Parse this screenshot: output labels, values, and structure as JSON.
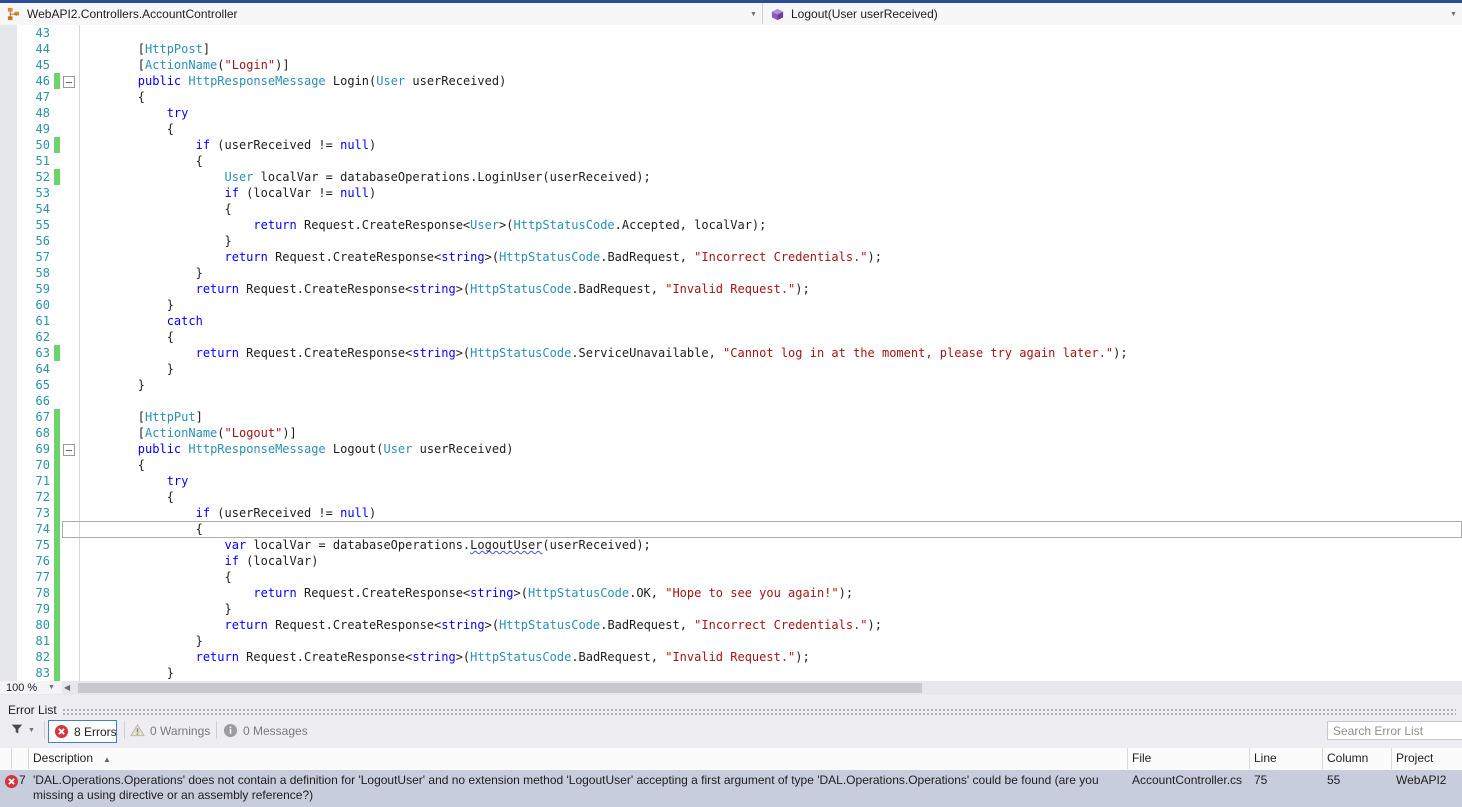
{
  "nav": {
    "type_combo": "WebAPI2.Controllers.AccountController",
    "member_combo": "Logout(User userReceived)"
  },
  "editor": {
    "zoom": "100 %",
    "lines": [
      {
        "n": 43,
        "seg": []
      },
      {
        "n": 44,
        "seg": [
          [
            "        [",
            "p"
          ],
          [
            "HttpPost",
            "t"
          ],
          [
            "]",
            "p"
          ]
        ]
      },
      {
        "n": 45,
        "seg": [
          [
            "        [",
            "p"
          ],
          [
            "ActionName",
            "t"
          ],
          [
            "(",
            "p"
          ],
          [
            "\"Login\"",
            "s"
          ],
          [
            ")]",
            "p"
          ]
        ]
      },
      {
        "n": 46,
        "chg": 1,
        "fold": 1,
        "seg": [
          [
            "        ",
            "p"
          ],
          [
            "public",
            "k"
          ],
          [
            " ",
            "p"
          ],
          [
            "HttpResponseMessage",
            "t"
          ],
          [
            " Login(",
            "p"
          ],
          [
            "User",
            "t"
          ],
          [
            " userReceived)",
            "p"
          ]
        ]
      },
      {
        "n": 47,
        "seg": [
          [
            "        {",
            "p"
          ]
        ]
      },
      {
        "n": 48,
        "seg": [
          [
            "            ",
            "p"
          ],
          [
            "try",
            "k"
          ]
        ]
      },
      {
        "n": 49,
        "seg": [
          [
            "            {",
            "p"
          ]
        ]
      },
      {
        "n": 50,
        "chg": 1,
        "seg": [
          [
            "                ",
            "p"
          ],
          [
            "if",
            "k"
          ],
          [
            " (userReceived != ",
            "p"
          ],
          [
            "null",
            "k"
          ],
          [
            ")",
            "p"
          ]
        ]
      },
      {
        "n": 51,
        "seg": [
          [
            "                {",
            "p"
          ]
        ]
      },
      {
        "n": 52,
        "chg": 1,
        "seg": [
          [
            "                    ",
            "p"
          ],
          [
            "User",
            "t"
          ],
          [
            " localVar = databaseOperations.LoginUser(userReceived);",
            "p"
          ]
        ]
      },
      {
        "n": 53,
        "seg": [
          [
            "                    ",
            "p"
          ],
          [
            "if",
            "k"
          ],
          [
            " (localVar != ",
            "p"
          ],
          [
            "null",
            "k"
          ],
          [
            ")",
            "p"
          ]
        ]
      },
      {
        "n": 54,
        "seg": [
          [
            "                    {",
            "p"
          ]
        ]
      },
      {
        "n": 55,
        "seg": [
          [
            "                        ",
            "p"
          ],
          [
            "return",
            "k"
          ],
          [
            " Request.CreateResponse<",
            "p"
          ],
          [
            "User",
            "t"
          ],
          [
            ">(",
            "p"
          ],
          [
            "HttpStatusCode",
            "t"
          ],
          [
            ".Accepted, localVar);",
            "p"
          ]
        ]
      },
      {
        "n": 56,
        "seg": [
          [
            "                    }",
            "p"
          ]
        ]
      },
      {
        "n": 57,
        "seg": [
          [
            "                    ",
            "p"
          ],
          [
            "return",
            "k"
          ],
          [
            " Request.CreateResponse<",
            "p"
          ],
          [
            "string",
            "k"
          ],
          [
            ">(",
            "p"
          ],
          [
            "HttpStatusCode",
            "t"
          ],
          [
            ".BadRequest, ",
            "p"
          ],
          [
            "\"Incorrect Credentials.\"",
            "s"
          ],
          [
            ");",
            "p"
          ]
        ]
      },
      {
        "n": 58,
        "seg": [
          [
            "                }",
            "p"
          ]
        ]
      },
      {
        "n": 59,
        "seg": [
          [
            "                ",
            "p"
          ],
          [
            "return",
            "k"
          ],
          [
            " Request.CreateResponse<",
            "p"
          ],
          [
            "string",
            "k"
          ],
          [
            ">(",
            "p"
          ],
          [
            "HttpStatusCode",
            "t"
          ],
          [
            ".BadRequest, ",
            "p"
          ],
          [
            "\"Invalid Request.\"",
            "s"
          ],
          [
            ");",
            "p"
          ]
        ]
      },
      {
        "n": 60,
        "seg": [
          [
            "            }",
            "p"
          ]
        ]
      },
      {
        "n": 61,
        "seg": [
          [
            "            ",
            "p"
          ],
          [
            "catch",
            "k"
          ]
        ]
      },
      {
        "n": 62,
        "seg": [
          [
            "            {",
            "p"
          ]
        ]
      },
      {
        "n": 63,
        "chg": 1,
        "seg": [
          [
            "                ",
            "p"
          ],
          [
            "return",
            "k"
          ],
          [
            " Request.CreateResponse<",
            "p"
          ],
          [
            "string",
            "k"
          ],
          [
            ">(",
            "p"
          ],
          [
            "HttpStatusCode",
            "t"
          ],
          [
            ".ServiceUnavailable, ",
            "p"
          ],
          [
            "\"Cannot log in at the moment, please try again later.\"",
            "s"
          ],
          [
            ");",
            "p"
          ]
        ]
      },
      {
        "n": 64,
        "seg": [
          [
            "            }",
            "p"
          ]
        ]
      },
      {
        "n": 65,
        "seg": [
          [
            "        }",
            "p"
          ]
        ]
      },
      {
        "n": 66,
        "seg": []
      },
      {
        "n": 67,
        "chg": 1,
        "seg": [
          [
            "        [",
            "p"
          ],
          [
            "HttpPut",
            "t"
          ],
          [
            "]",
            "p"
          ]
        ]
      },
      {
        "n": 68,
        "chg": 1,
        "seg": [
          [
            "        [",
            "p"
          ],
          [
            "ActionName",
            "t"
          ],
          [
            "(",
            "p"
          ],
          [
            "\"Logout\"",
            "s"
          ],
          [
            ")]",
            "p"
          ]
        ]
      },
      {
        "n": 69,
        "chg": 1,
        "fold": 1,
        "seg": [
          [
            "        ",
            "p"
          ],
          [
            "public",
            "k"
          ],
          [
            " ",
            "p"
          ],
          [
            "HttpResponseMessage",
            "t"
          ],
          [
            " Logout(",
            "p"
          ],
          [
            "User",
            "t"
          ],
          [
            " userReceived)",
            "p"
          ]
        ]
      },
      {
        "n": 70,
        "chg": 1,
        "seg": [
          [
            "        {",
            "p"
          ]
        ]
      },
      {
        "n": 71,
        "chg": 1,
        "seg": [
          [
            "            ",
            "p"
          ],
          [
            "try",
            "k"
          ]
        ]
      },
      {
        "n": 72,
        "chg": 1,
        "seg": [
          [
            "            {",
            "p"
          ]
        ]
      },
      {
        "n": 73,
        "chg": 1,
        "seg": [
          [
            "                ",
            "p"
          ],
          [
            "if",
            "k"
          ],
          [
            " (userReceived != ",
            "p"
          ],
          [
            "null",
            "k"
          ],
          [
            ")",
            "p"
          ]
        ]
      },
      {
        "n": 74,
        "chg": 1,
        "cur": 1,
        "seg": [
          [
            "                {",
            "p"
          ]
        ]
      },
      {
        "n": 75,
        "chg": 1,
        "seg": [
          [
            "                    ",
            "p"
          ],
          [
            "var",
            "k"
          ],
          [
            " localVar = databaseOperations.",
            "p"
          ],
          [
            "LogoutUser",
            "e"
          ],
          [
            "(userReceived);",
            "p"
          ]
        ]
      },
      {
        "n": 76,
        "chg": 1,
        "seg": [
          [
            "                    ",
            "p"
          ],
          [
            "if",
            "k"
          ],
          [
            " (localVar)",
            "p"
          ]
        ]
      },
      {
        "n": 77,
        "chg": 1,
        "seg": [
          [
            "                    {",
            "p"
          ]
        ]
      },
      {
        "n": 78,
        "chg": 1,
        "seg": [
          [
            "                        ",
            "p"
          ],
          [
            "return",
            "k"
          ],
          [
            " Request.CreateResponse<",
            "p"
          ],
          [
            "string",
            "k"
          ],
          [
            ">(",
            "p"
          ],
          [
            "HttpStatusCode",
            "t"
          ],
          [
            ".OK, ",
            "p"
          ],
          [
            "\"Hope to see you again!\"",
            "s"
          ],
          [
            ");",
            "p"
          ]
        ]
      },
      {
        "n": 79,
        "chg": 1,
        "seg": [
          [
            "                    }",
            "p"
          ]
        ]
      },
      {
        "n": 80,
        "chg": 1,
        "seg": [
          [
            "                    ",
            "p"
          ],
          [
            "return",
            "k"
          ],
          [
            " Request.CreateResponse<",
            "p"
          ],
          [
            "string",
            "k"
          ],
          [
            ">(",
            "p"
          ],
          [
            "HttpStatusCode",
            "t"
          ],
          [
            ".BadRequest, ",
            "p"
          ],
          [
            "\"Incorrect Credentials.\"",
            "s"
          ],
          [
            ");",
            "p"
          ]
        ]
      },
      {
        "n": 81,
        "chg": 1,
        "seg": [
          [
            "                }",
            "p"
          ]
        ]
      },
      {
        "n": 82,
        "chg": 1,
        "seg": [
          [
            "                ",
            "p"
          ],
          [
            "return",
            "k"
          ],
          [
            " Request.CreateResponse<",
            "p"
          ],
          [
            "string",
            "k"
          ],
          [
            ">(",
            "p"
          ],
          [
            "HttpStatusCode",
            "t"
          ],
          [
            ".BadRequest, ",
            "p"
          ],
          [
            "\"Invalid Request.\"",
            "s"
          ],
          [
            ");",
            "p"
          ]
        ]
      },
      {
        "n": 83,
        "chg": 1,
        "seg": [
          [
            "            }",
            "p"
          ]
        ]
      }
    ]
  },
  "error_list": {
    "title": "Error List",
    "filters": {
      "errors": "8 Errors",
      "warnings": "0 Warnings",
      "messages": "0 Messages"
    },
    "search_placeholder": "Search Error List",
    "columns": {
      "description": "Description",
      "file": "File",
      "line": "Line",
      "column": "Column",
      "project": "Project"
    },
    "rows": [
      {
        "severity": "error",
        "num": "7",
        "description": "'DAL.Operations.Operations' does not contain a definition for 'LogoutUser' and no extension method 'LogoutUser' accepting a first argument of type 'DAL.Operations.Operations' could be found (are you missing a using directive or an assembly reference?)",
        "file": "AccountController.cs",
        "line": "75",
        "column": "55",
        "project": "WebAPI2"
      }
    ]
  },
  "colors": {
    "keyword": "#0000ff",
    "type": "#2b91af",
    "string": "#a31515",
    "line_number": "#2b91af",
    "change_bar": "#6ed26e",
    "error_red": "#d3373c",
    "selected_row": "#c8cdde",
    "accent_border": "#3e7fd8",
    "top_strip": "#2b4c96"
  }
}
